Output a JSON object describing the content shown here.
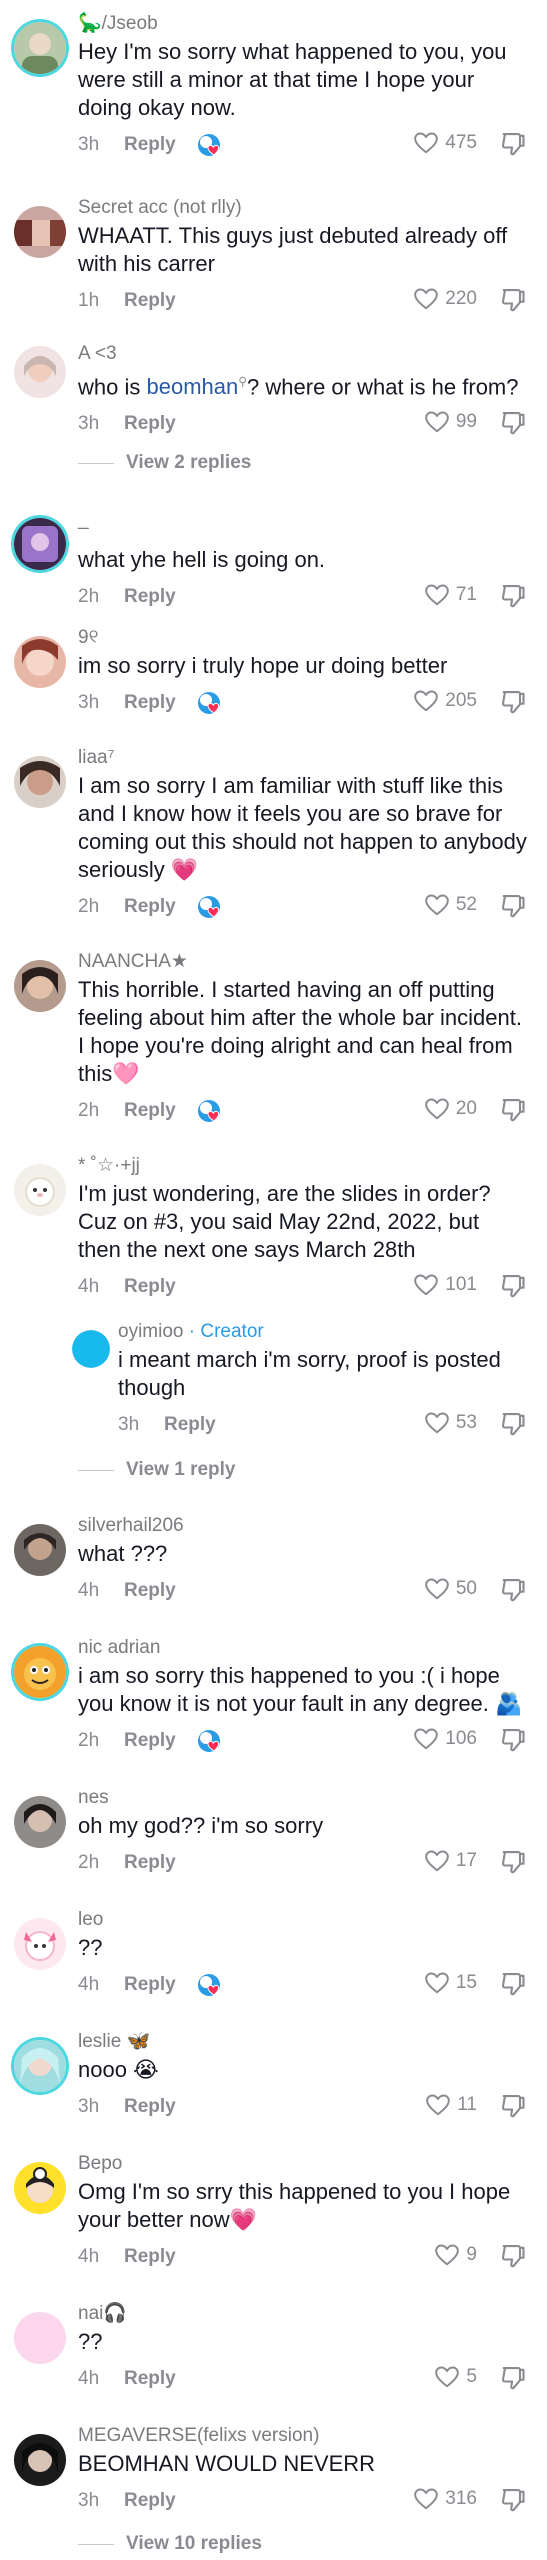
{
  "comments": [
    {
      "username": "🦕/Jseob",
      "text": "Hey I'm so sorry what happened to you, you were still a minor at that time I hope your doing okay now.",
      "time": "3h",
      "reply": "Reply",
      "likes": "475",
      "creator_liked": true
    },
    {
      "username": "Secret acc (not rlly)",
      "text": "WHAATT. This guys just debuted already off with his carrer",
      "time": "1h",
      "reply": "Reply",
      "likes": "220",
      "creator_liked": false
    },
    {
      "username": "A <3",
      "text_before": "who is ",
      "mention": "beomhan",
      "text_after": "? where or what is he from?",
      "time": "3h",
      "reply": "Reply",
      "likes": "99",
      "creator_liked": false,
      "view_replies": "View 2 replies"
    },
    {
      "username": "_",
      "text": "what yhe hell is going on.",
      "time": "2h",
      "reply": "Reply",
      "likes": "71",
      "creator_liked": false
    },
    {
      "username": "9୧",
      "text": "im so sorry i truly hope ur doing better",
      "time": "3h",
      "reply": "Reply",
      "likes": "205",
      "creator_liked": true
    },
    {
      "username": "liaa⁷",
      "text": "I am so sorry I am familiar with stuff like this and I know how it feels you are so brave for coming out this should not happen to anybody seriously 💗",
      "time": "2h",
      "reply": "Reply",
      "likes": "52",
      "creator_liked": true
    },
    {
      "username": "NAANCHA★",
      "text": "This horrible. I started having an off putting feeling about him after the whole bar incident. I hope you're doing alright and can heal from this🩷",
      "time": "2h",
      "reply": "Reply",
      "likes": "20",
      "creator_liked": true
    },
    {
      "username": "* ˚☆·+jj",
      "text": "I'm just wondering, are the slides in order? Cuz on #3, you said May 22nd, 2022, but then the next one says March 28th",
      "time": "4h",
      "reply": "Reply",
      "likes": "101",
      "creator_liked": false,
      "sub_reply": {
        "username": "oyimioo",
        "creator_label": " · Creator",
        "text": "i meant march i'm sorry, proof is posted though",
        "time": "3h",
        "reply": "Reply",
        "likes": "53"
      },
      "view_replies": "View 1 reply"
    },
    {
      "username": "silverhail206",
      "text": "what ???",
      "time": "4h",
      "reply": "Reply",
      "likes": "50",
      "creator_liked": false
    },
    {
      "username": "nic adrian",
      "text": "i am so sorry this happened to you :( i hope you know it is not your fault in any degree. 🫂",
      "time": "2h",
      "reply": "Reply",
      "likes": "106",
      "creator_liked": true
    },
    {
      "username": "nes",
      "text": "oh my god?? i'm so sorry",
      "time": "2h",
      "reply": "Reply",
      "likes": "17",
      "creator_liked": false
    },
    {
      "username": "leo",
      "text": "??",
      "time": "4h",
      "reply": "Reply",
      "likes": "15",
      "creator_liked": true
    },
    {
      "username": "leslie 🦋",
      "text": "nooo 😭",
      "time": "3h",
      "reply": "Reply",
      "likes": "11",
      "creator_liked": false
    },
    {
      "username": "Bepo",
      "text": "Omg I'm so srry this happened to you I hope your better now💗",
      "time": "4h",
      "reply": "Reply",
      "likes": "9",
      "creator_liked": false
    },
    {
      "username": "nai🎧",
      "text": "??",
      "time": "4h",
      "reply": "Reply",
      "likes": "5",
      "creator_liked": false
    },
    {
      "username": "MEGAVERSE(felixs version)",
      "text": "BEOMHAN WOULD NEVERR",
      "time": "3h",
      "reply": "Reply",
      "likes": "316",
      "creator_liked": false,
      "view_replies": "View 10 replies"
    }
  ],
  "icons": {
    "like": "heart-outline-icon",
    "dislike": "thumbs-down-icon",
    "creator_liked": "creator-liked-heart-icon",
    "search": "search-icon"
  },
  "colors": {
    "accent_ring": "#4cd6e0",
    "creator": "#2b9be4",
    "mention": "#2b5aa5",
    "like_red": "#fe2c55"
  }
}
